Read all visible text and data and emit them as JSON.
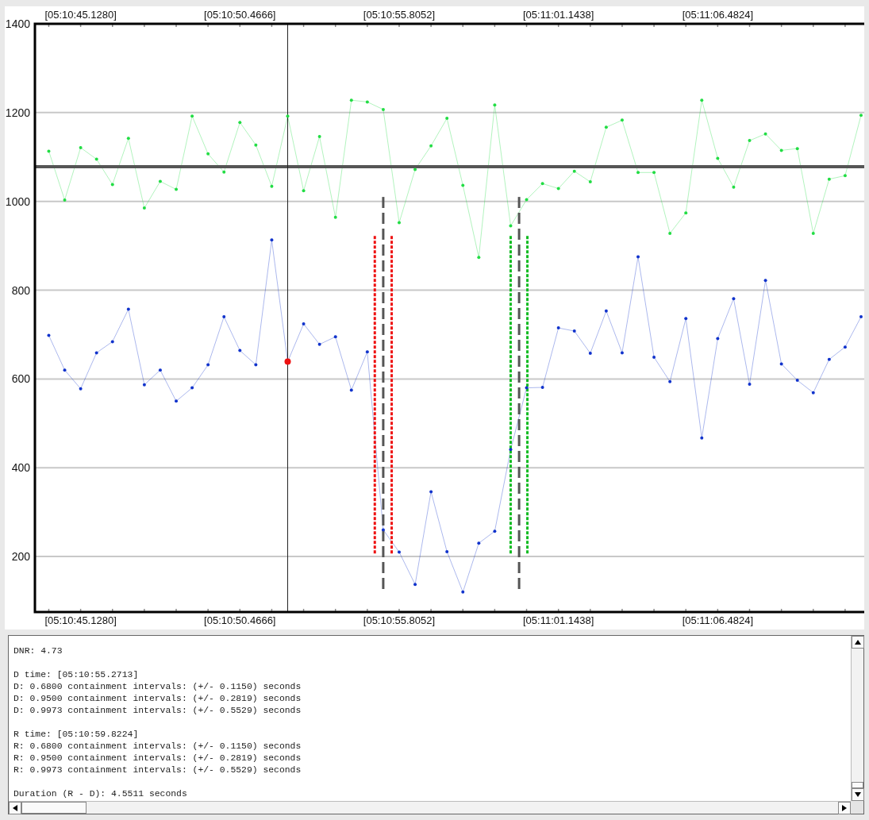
{
  "chart": {
    "top_axis_labels": [
      "[05:10:45.1280]",
      "[05:10:50.4666]",
      "[05:10:55.8052]",
      "[05:11:01.1438]",
      "[05:11:06.4824]"
    ],
    "chart_data": {
      "type": "line",
      "categories": [
        null,
        null,
        "[05:10:45.1280]",
        null,
        null,
        null,
        null,
        null,
        null,
        null,
        null,
        null,
        "[05:10:50.4666]",
        null,
        null,
        null,
        null,
        null,
        null,
        null,
        null,
        null,
        "[05:10:55.8052]",
        null,
        null,
        null,
        null,
        null,
        null,
        null,
        null,
        null,
        "[05:11:01.1438]",
        null,
        null,
        null,
        null,
        null,
        null,
        null,
        null,
        null,
        "[05:11:06.4824]",
        null,
        null,
        null,
        null,
        null,
        null,
        null,
        null,
        null
      ],
      "series": [
        {
          "color": "#22dd44",
          "values": [
            1113,
            1003,
            1121,
            1095,
            1038,
            1142,
            985,
            1045,
            1027,
            1192,
            1107,
            1066,
            1178,
            1127,
            1034,
            1192,
            1024,
            1146,
            964,
            1228,
            1224,
            1207,
            952,
            1072,
            1125,
            1187,
            1036,
            874,
            1217,
            945,
            1004,
            1040,
            1029,
            1068,
            1044,
            1167,
            1183,
            1065,
            1065,
            928,
            974,
            1228,
            1097,
            1032,
            1137,
            1152,
            1115,
            1119,
            928,
            1050,
            1058,
            1194
          ]
        },
        {
          "color": "#1133cc",
          "values": [
            698,
            620,
            578,
            659,
            684,
            757,
            587,
            620,
            550,
            580,
            632,
            740,
            664,
            632,
            913,
            639,
            724,
            678,
            695,
            575,
            661,
            260,
            210,
            137,
            346,
            211,
            120,
            230,
            257,
            441,
            580,
            581,
            715,
            708,
            658,
            753,
            659,
            875,
            649,
            594,
            736,
            467,
            691,
            781,
            588,
            822,
            634,
            597,
            569,
            644,
            672,
            740
          ]
        }
      ],
      "ylim": [
        75,
        1400
      ],
      "grid": true,
      "yticks": [
        200,
        400,
        600,
        800,
        1000,
        1200,
        1400
      ],
      "ref_lines": [
        {
          "axis": "y",
          "value": 1078,
          "color": "#555555"
        }
      ]
    }
  },
  "output": {
    "blocks": [
      [
        "DNR: 4.73"
      ],
      [
        "D time: [05:10:55.2713]",
        "D: 0.6800 containment intervals: (+/- 0.1150) seconds",
        "D: 0.9500 containment intervals: (+/- 0.2819) seconds",
        "D: 0.9973 containment intervals: (+/- 0.5529) seconds"
      ],
      [
        "R time: [05:10:59.8224]",
        "R: 0.6800 containment intervals: (+/- 0.1150) seconds",
        "R: 0.9500 containment intervals: (+/- 0.2819) seconds",
        "R: 0.9973 containment intervals: (+/- 0.5529) seconds"
      ],
      [
        "Duration (R - D): 4.5511 seconds"
      ]
    ]
  }
}
